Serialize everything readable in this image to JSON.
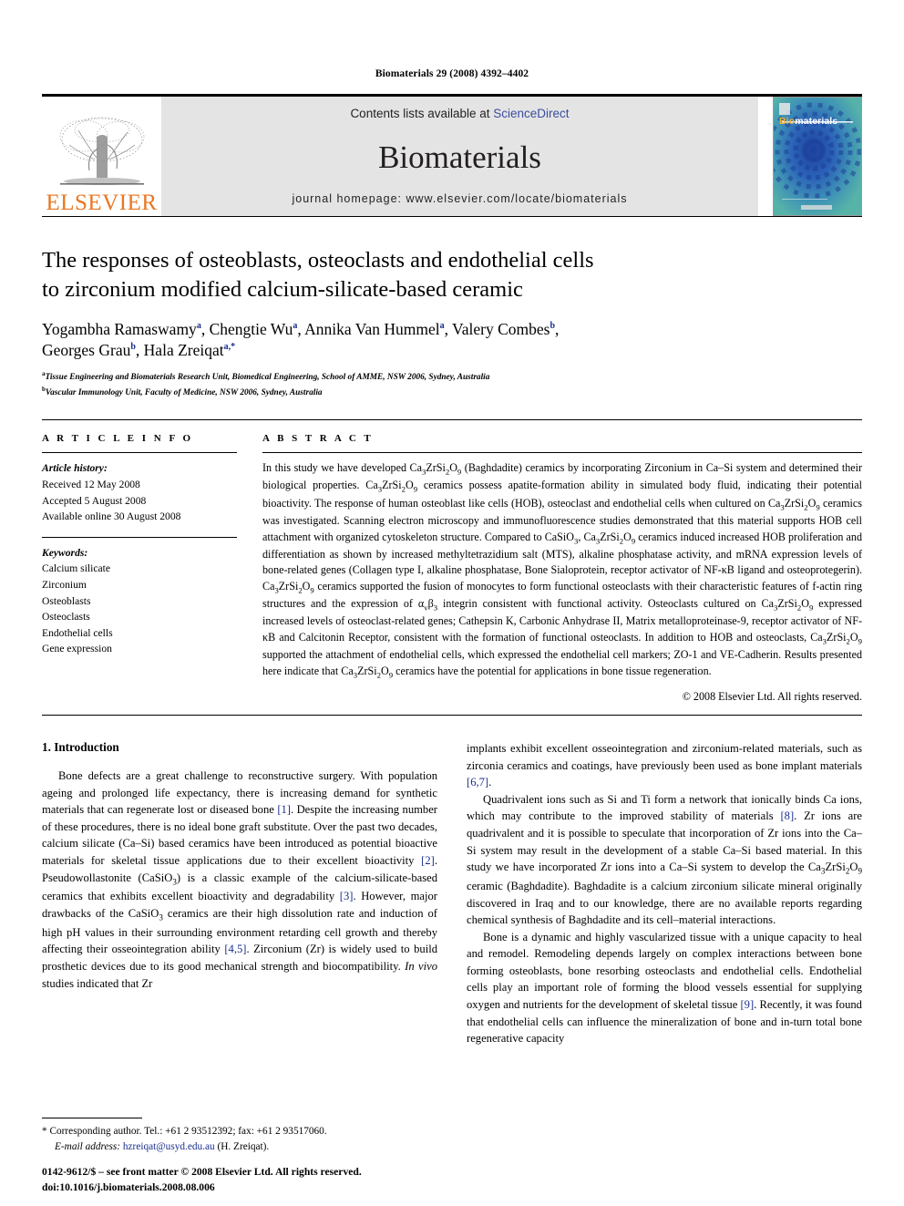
{
  "running_head": "Biomaterials 29 (2008) 4392–4402",
  "masthead": {
    "contents_prefix": "Contents lists available at ",
    "sciencedirect": "ScienceDirect",
    "journal_name": "Biomaterials",
    "homepage": "journal homepage: www.elsevier.com/locate/biomaterials",
    "publisher_wordmark": "ELSEVIER",
    "cover_title_a": "Bio",
    "cover_title_b": "materials",
    "accent_orange": "#E87722",
    "link_blue": "#3b4ea0",
    "band_gray": "#e4e4e4"
  },
  "article": {
    "title_line1": "The responses of osteoblasts, osteoclasts and endothelial cells",
    "title_line2": "to zirconium modified calcium-silicate-based ceramic",
    "authors": [
      {
        "name": "Yogambha Ramaswamy",
        "mark": "a",
        "sep": ", "
      },
      {
        "name": "Chengtie Wu",
        "mark": "a",
        "sep": ", "
      },
      {
        "name": "Annika Van Hummel",
        "mark": "a",
        "sep": ", "
      },
      {
        "name": "Valery Combes",
        "mark": "b",
        "sep": ","
      },
      {
        "name": "Georges Grau",
        "mark": "b",
        "sep": ", "
      },
      {
        "name": "Hala Zreiqat",
        "mark": "a,*",
        "sep": ""
      }
    ],
    "affiliations": [
      {
        "mark": "a",
        "text": "Tissue Engineering and Biomaterials Research Unit, Biomedical Engineering, School of AMME, NSW 2006, Sydney, Australia"
      },
      {
        "mark": "b",
        "text": "Vascular Immunology Unit, Faculty of Medicine, NSW 2006, Sydney, Australia"
      }
    ]
  },
  "article_info": {
    "label": "A R T I C L E  I N F O",
    "history_head": "Article history:",
    "history": [
      "Received 12 May 2008",
      "Accepted 5 August 2008",
      "Available online 30 August 2008"
    ],
    "keywords_head": "Keywords:",
    "keywords": [
      "Calcium silicate",
      "Zirconium",
      "Osteoblasts",
      "Osteoclasts",
      "Endothelial cells",
      "Gene expression"
    ]
  },
  "abstract": {
    "label": "A B S T R A C T",
    "text": "In this study we have developed Ca3ZrSi2O9 (Baghdadite) ceramics by incorporating Zirconium in Ca–Si system and determined their biological properties. Ca3ZrSi2O9 ceramics possess apatite-formation ability in simulated body fluid, indicating their potential bioactivity. The response of human osteoblast like cells (HOB), osteoclast and endothelial cells when cultured on Ca3ZrSi2O9 ceramics was investigated. Scanning electron microscopy and immunofluorescence studies demonstrated that this material supports HOB cell attachment with organized cytoskeleton structure. Compared to CaSiO3, Ca3ZrSi2O9 ceramics induced increased HOB proliferation and differentiation as shown by increased methyltetrazidium salt (MTS), alkaline phosphatase activity, and mRNA expression levels of bone-related genes (Collagen type I, alkaline phosphatase, Bone Sialoprotein, receptor activator of NF-κB ligand and osteoprotegerin). Ca3ZrSi2O9 ceramics supported the fusion of monocytes to form functional osteoclasts with their characteristic features of f-actin ring structures and the expression of αvβ3 integrin consistent with functional activity. Osteoclasts cultured on Ca3ZrSi2O9 expressed increased levels of osteoclast-related genes; Cathepsin K, Carbonic Anhydrase II, Matrix metalloproteinase-9, receptor activator of NF-κB and Calcitonin Receptor, consistent with the formation of functional osteoclasts. In addition to HOB and osteoclasts, Ca3ZrSi2O9 supported the attachment of endothelial cells, which expressed the endothelial cell markers; ZO-1 and VE-Cadherin. Results presented here indicate that Ca3ZrSi2O9 ceramics have the potential for applications in bone tissue regeneration.",
    "copyright": "© 2008 Elsevier Ltd. All rights reserved."
  },
  "body": {
    "section_heading": "1. Introduction",
    "left_paragraphs": [
      "Bone defects are a great challenge to reconstructive surgery. With population ageing and prolonged life expectancy, there is increasing demand for synthetic materials that can regenerate lost or diseased bone [1]. Despite the increasing number of these procedures, there is no ideal bone graft substitute. Over the past two decades, calcium silicate (Ca–Si) based ceramics have been introduced as potential bioactive materials for skeletal tissue applications due to their excellent bioactivity [2]. Pseudowollastonite (CaSiO3) is a classic example of the calcium-silicate-based ceramics that exhibits excellent bioactivity and degradability [3]. However, major drawbacks of the CaSiO3 ceramics are their high dissolution rate and induction of high pH values in their surrounding environment retarding cell growth and thereby affecting their osseointegration ability [4,5]. Zirconium (Zr) is widely used to build prosthetic devices due to its good mechanical strength and biocompatibility. In vivo studies indicated that Zr"
    ],
    "right_paragraphs": [
      "implants exhibit excellent osseointegration and zirconium-related materials, such as zirconia ceramics and coatings, have previously been used as bone implant materials [6,7].",
      "Quadrivalent ions such as Si and Ti form a network that ionically binds Ca ions, which may contribute to the improved stability of materials [8]. Zr ions are quadrivalent and it is possible to speculate that incorporation of Zr ions into the Ca–Si system may result in the development of a stable Ca–Si based material. In this study we have incorporated Zr ions into a Ca–Si system to develop the Ca3ZrSi2O9 ceramic (Baghdadite). Baghdadite is a calcium zirconium silicate mineral originally discovered in Iraq and to our knowledge, there are no available reports regarding chemical synthesis of Baghdadite and its cell–material interactions.",
      "Bone is a dynamic and highly vascularized tissue with a unique capacity to heal and remodel. Remodeling depends largely on complex interactions between bone forming osteoblasts, bone resorbing osteoclasts and endothelial cells. Endothelial cells play an important role of forming the blood vessels essential for supplying oxygen and nutrients for the development of skeletal tissue [9]. Recently, it was found that endothelial cells can influence the mineralization of bone and in-turn total bone regenerative capacity"
    ]
  },
  "footnote": {
    "corresponding": "* Corresponding author. Tel.: +61 2 93512392; fax: +61 2 93517060.",
    "email_label": "E-mail address:",
    "email": "hzreiqat@usyd.edu.au",
    "email_suffix": "(H. Zreiqat)."
  },
  "footer": {
    "line1": "0142-9612/$ – see front matter © 2008 Elsevier Ltd. All rights reserved.",
    "line2": "doi:10.1016/j.biomaterials.2008.08.006"
  }
}
